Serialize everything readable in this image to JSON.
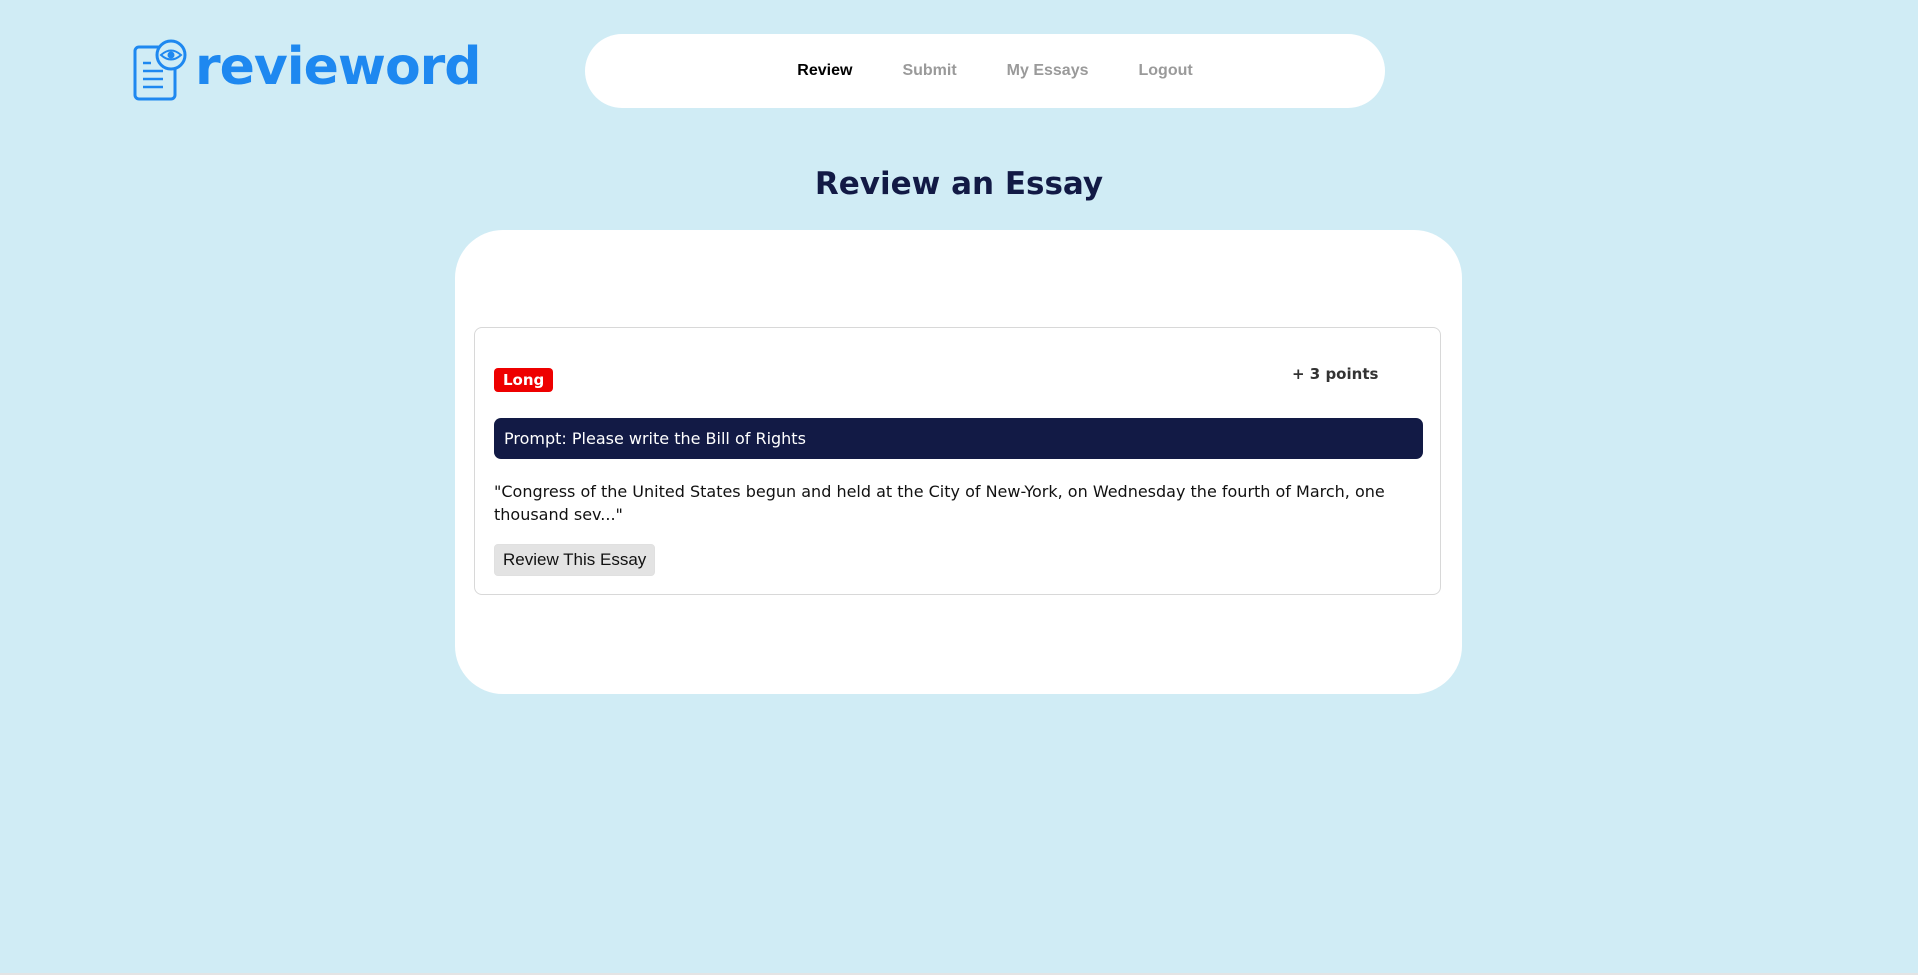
{
  "brand": {
    "name": "revieword",
    "color": "#1e88f0",
    "icon": "document-eye-icon"
  },
  "nav": {
    "items": [
      {
        "label": "Review",
        "active": true
      },
      {
        "label": "Submit",
        "active": false
      },
      {
        "label": "My Essays",
        "active": false
      },
      {
        "label": "Logout",
        "active": false
      }
    ]
  },
  "page": {
    "title": "Review an Essay",
    "background": "#d0ecf5"
  },
  "essay": {
    "length_badge": "Long",
    "badge_color": "#ee0000",
    "points": "+ 3 points",
    "prompt": "Prompt: Please write the Bill of Rights",
    "prompt_bg": "#121a45",
    "excerpt": "\"Congress of the United States begun and held at the City of New-York, on Wednesday the fourth of March, one thousand sev...\"",
    "review_button": "Review This Essay"
  }
}
